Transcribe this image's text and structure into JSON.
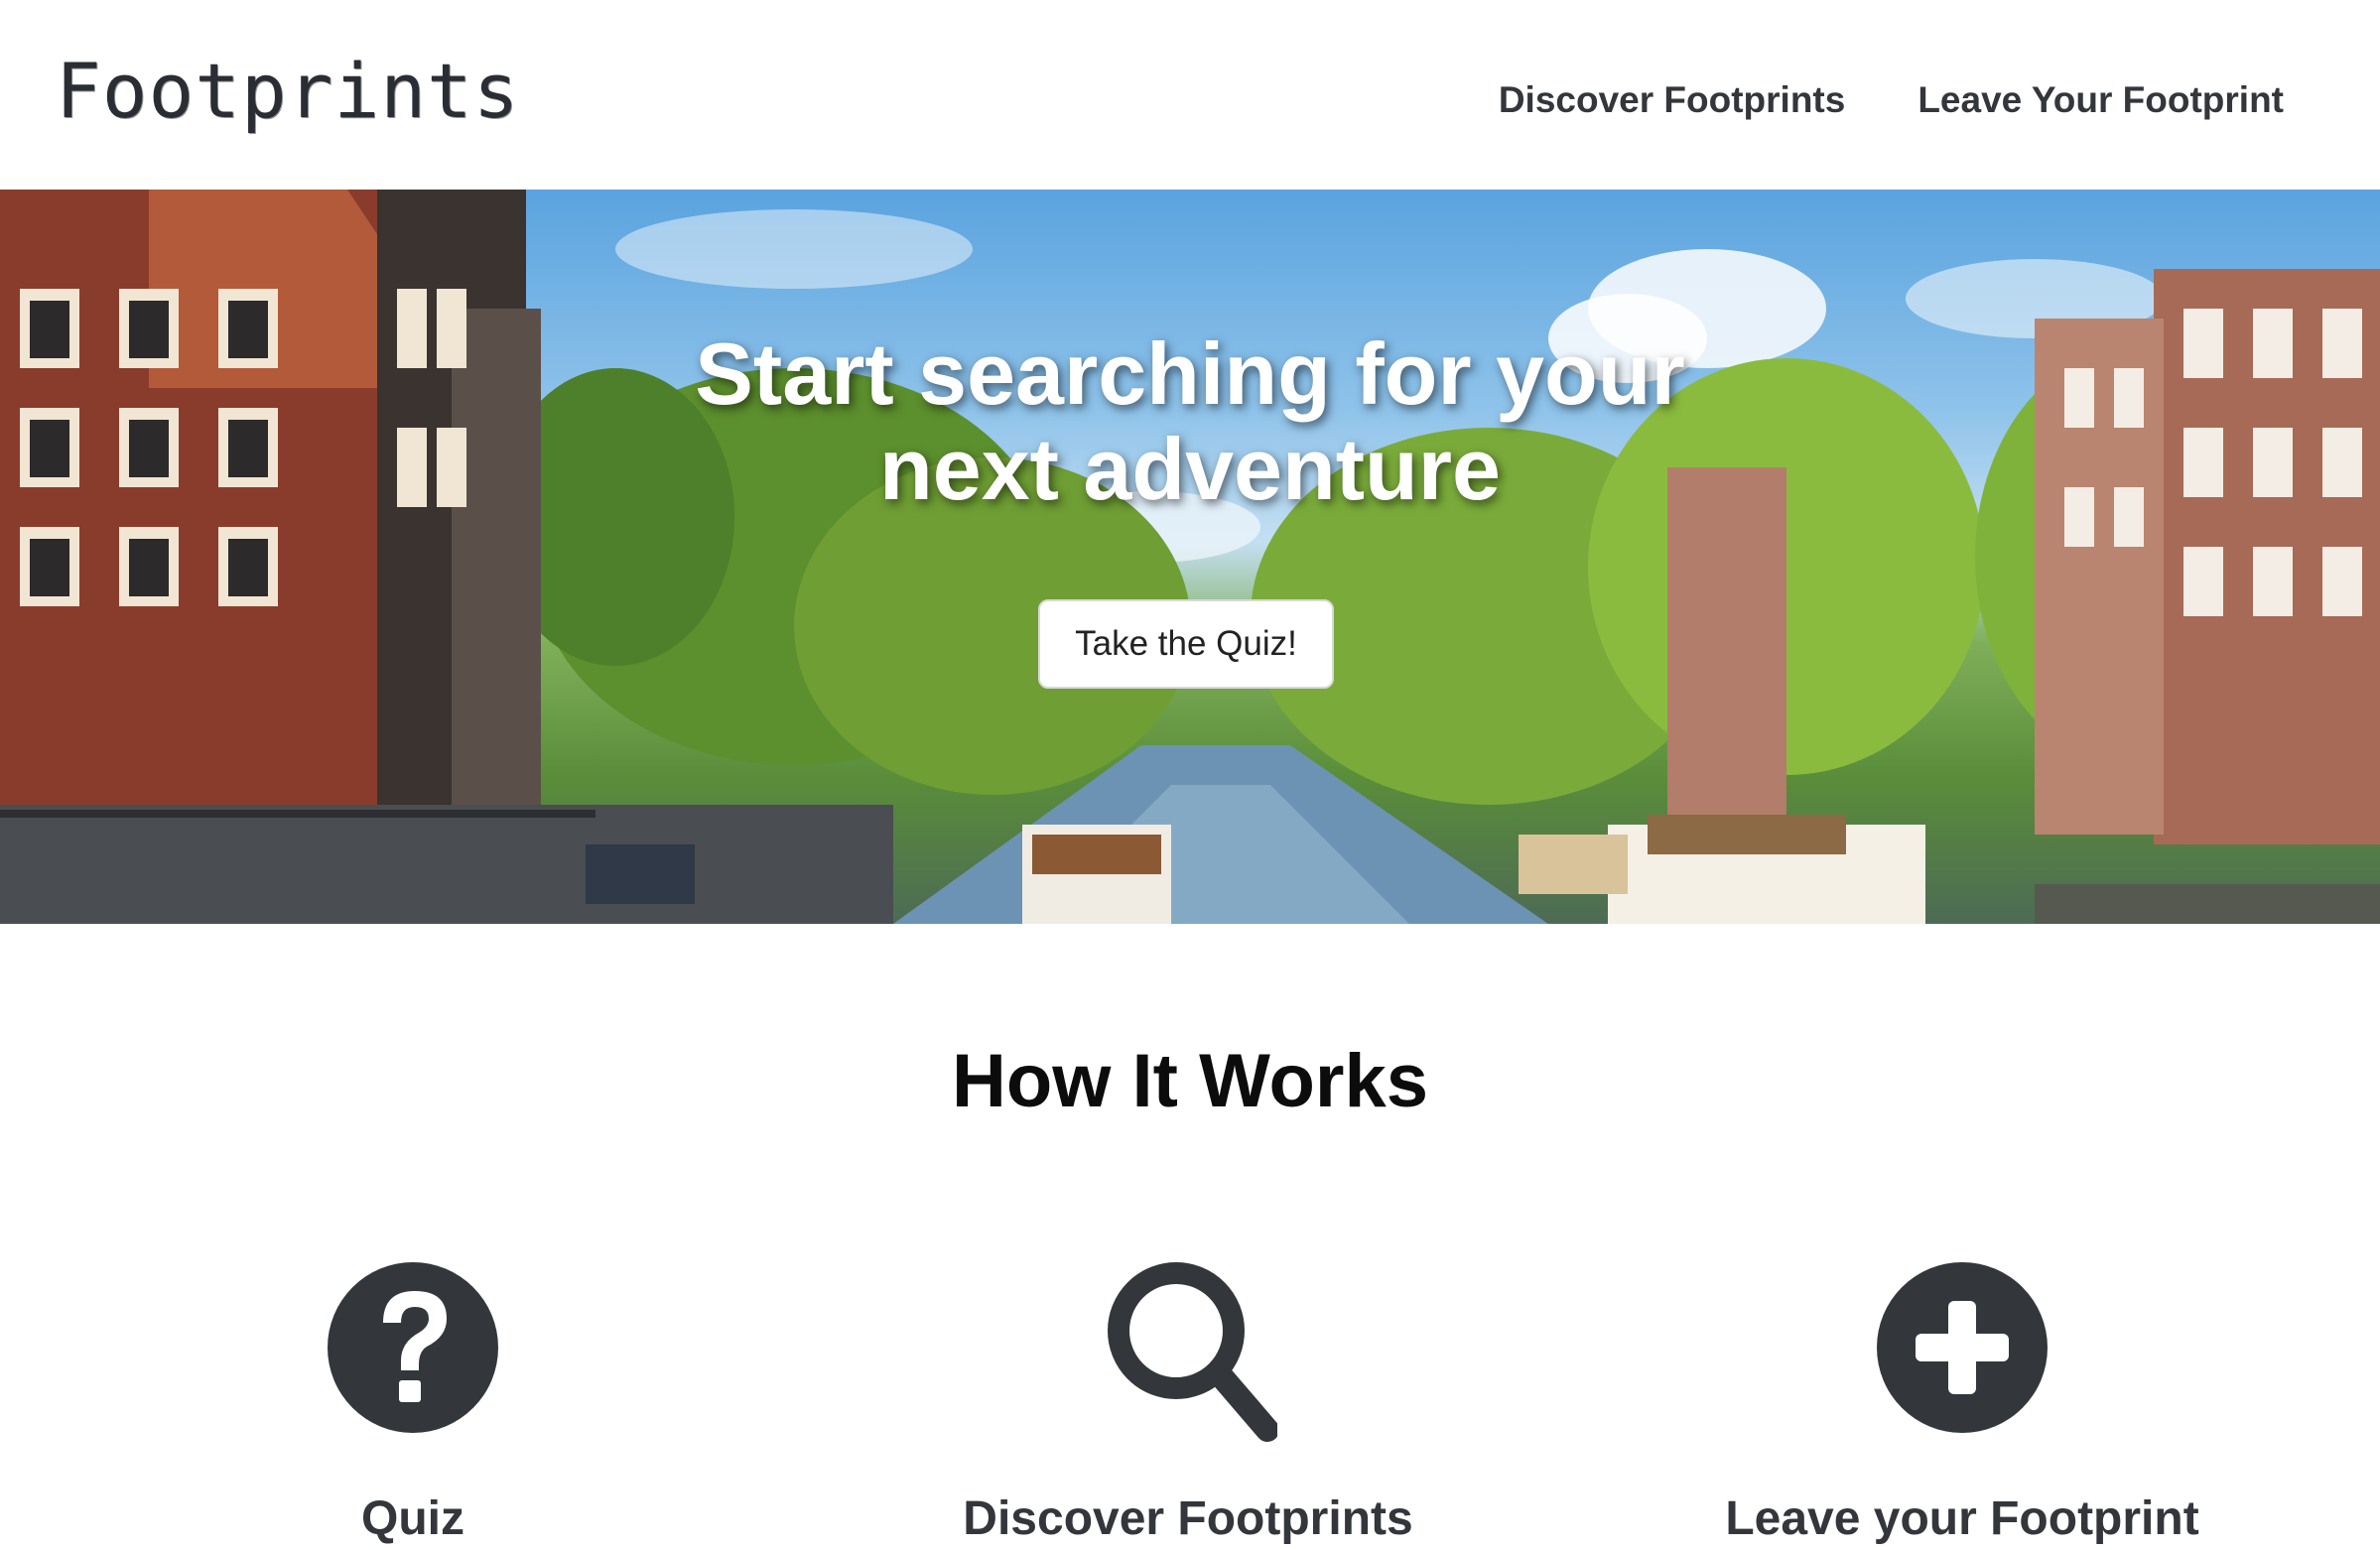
{
  "header": {
    "logo": "Footprints",
    "nav": [
      {
        "label": "Discover Footprints"
      },
      {
        "label": "Leave Your Footprint"
      }
    ]
  },
  "hero": {
    "title": "Start searching for your next adventure",
    "button_label": "Take the Quiz!"
  },
  "how_it_works": {
    "title": "How It Works",
    "features": [
      {
        "icon": "question-circle-icon",
        "label": "Quiz"
      },
      {
        "icon": "search-icon",
        "label": "Discover Footprints"
      },
      {
        "icon": "plus-circle-icon",
        "label": "Leave your Footprint"
      }
    ]
  },
  "colors": {
    "icon": "#33363b",
    "text": "#33363b",
    "heading": "#0c0c0c",
    "button_bg": "#ffffff"
  }
}
